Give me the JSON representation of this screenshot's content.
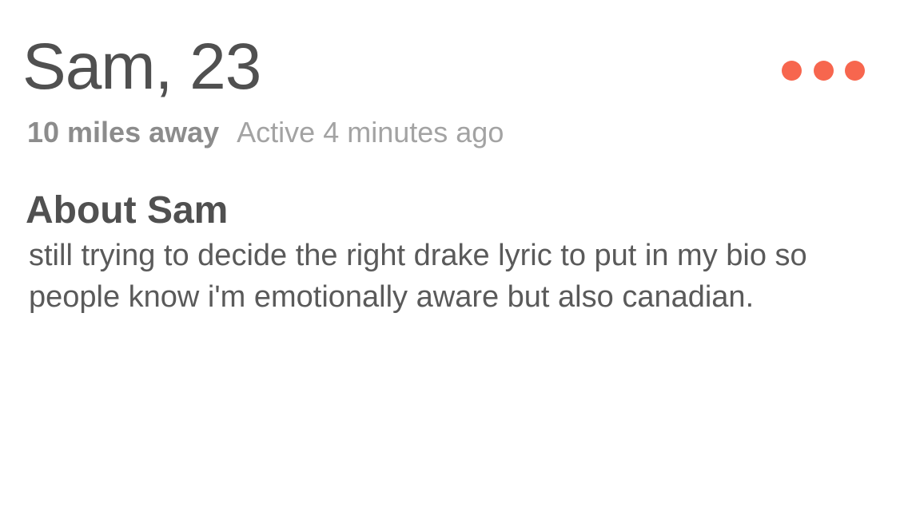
{
  "profile": {
    "name_age": "Sam, 23",
    "distance": "10 miles away",
    "active_status": "Active 4 minutes ago",
    "more_options_icon": "more-horizontal-icon",
    "accent_color": "#f7664e"
  },
  "about": {
    "heading": "About Sam",
    "bio": "still trying to decide the right drake lyric to put in my bio so people know i'm emotionally aware but also canadian."
  }
}
